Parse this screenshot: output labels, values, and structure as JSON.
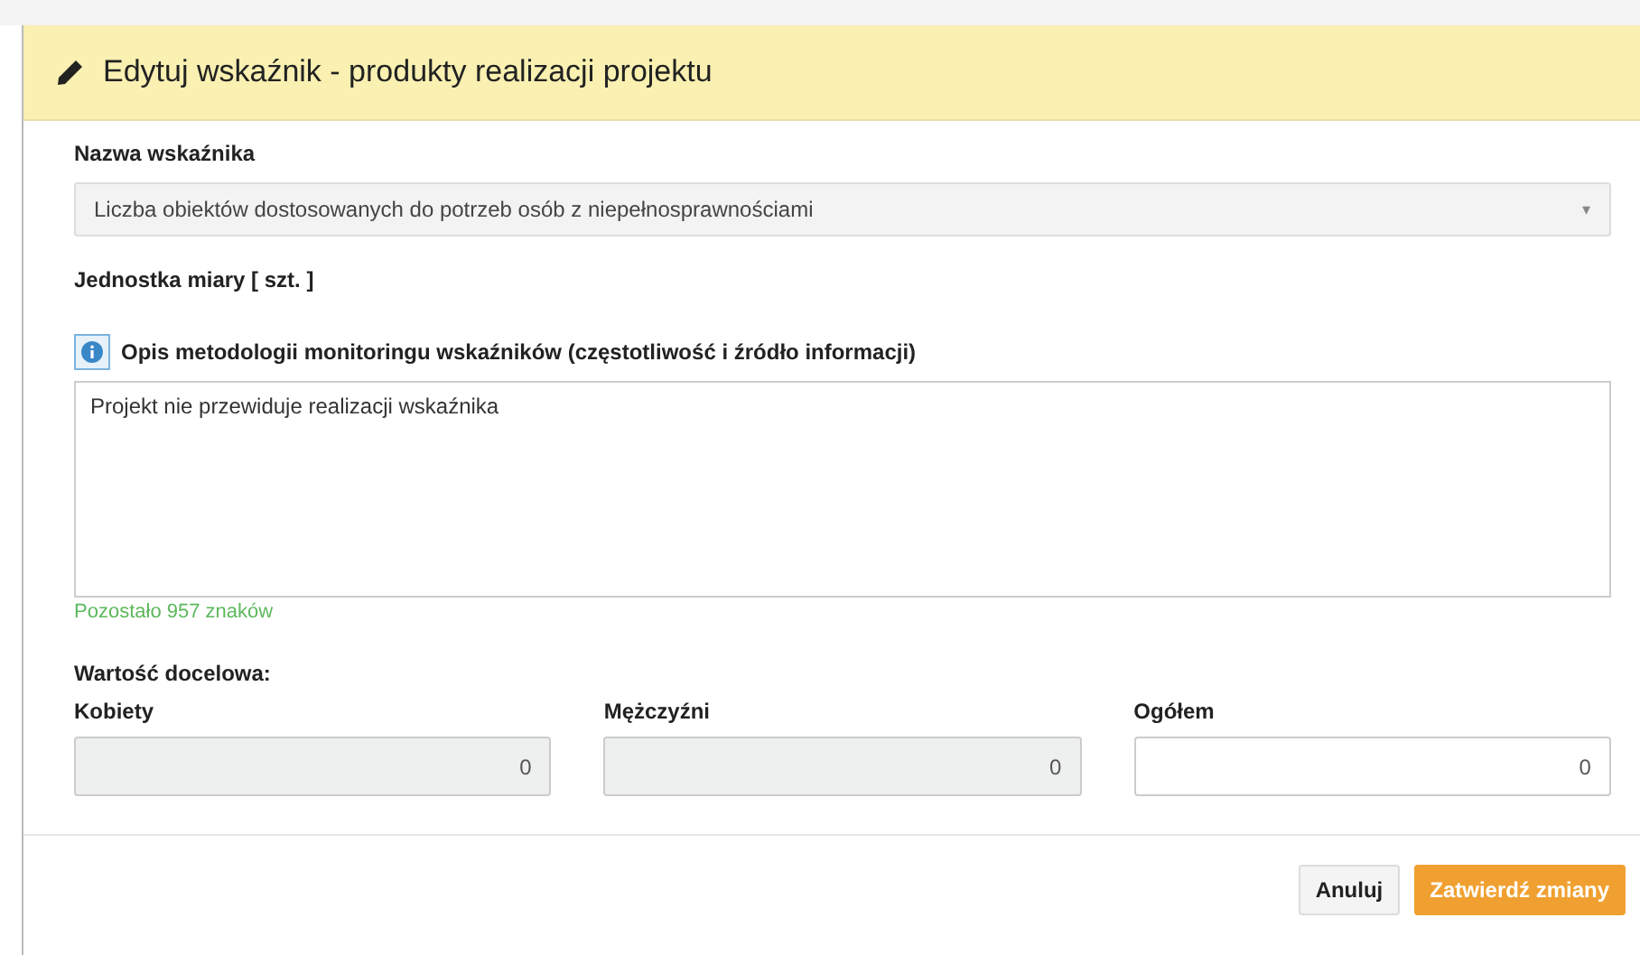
{
  "dialog": {
    "title": "Edytuj wskaźnik - produkty realizacji projektu"
  },
  "indicator_name": {
    "label": "Nazwa wskaźnika",
    "value": "Liczba obiektów dostosowanych do potrzeb osób z niepełnosprawnościami",
    "arrow": "▾"
  },
  "unit": {
    "label": "Jednostka miary [ szt. ]"
  },
  "methodology": {
    "label": "Opis metodologii monitoringu wskaźników (częstotliwość i źródło informacji)",
    "value": "Projekt nie przewiduje realizacji wskaźnika",
    "remaining": "Pozostało 957 znaków"
  },
  "target": {
    "label": "Wartość docelowa:",
    "fields": [
      {
        "label": "Kobiety",
        "value": "0",
        "disabled": true
      },
      {
        "label": "Mężczyźni",
        "value": "0",
        "disabled": true
      },
      {
        "label": "Ogółem",
        "value": "0",
        "disabled": false
      }
    ]
  },
  "buttons": [
    {
      "label": "Anuluj",
      "kind": "default"
    },
    {
      "label": "Zatwierdź zmiany",
      "kind": "primary"
    }
  ]
}
